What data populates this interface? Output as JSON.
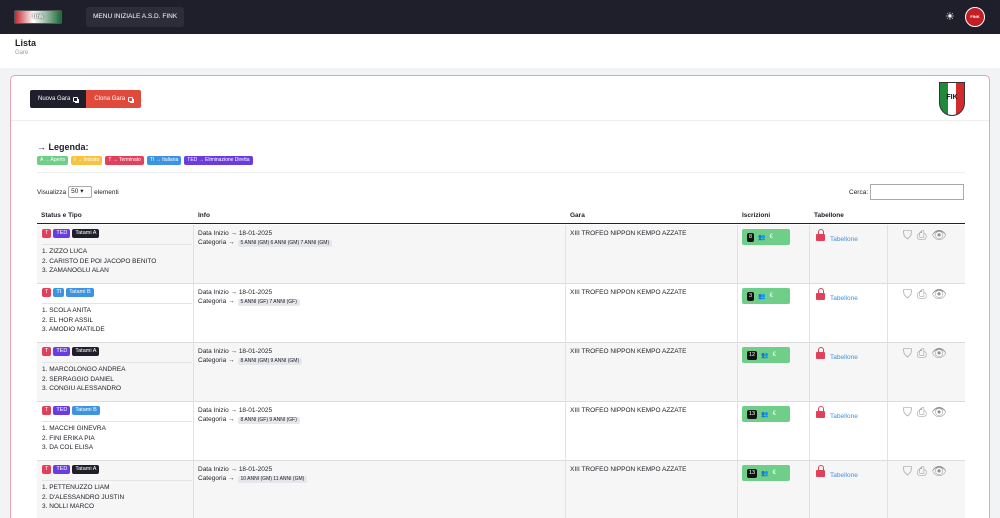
{
  "topbar": {
    "logo_text": "fink",
    "menu_label": "MENU INIZIALE A.S.D. FINK",
    "avatar_text": "FINK"
  },
  "header": {
    "title": "Lista",
    "breadcrumb": "Gare"
  },
  "actions": {
    "new_label": "Nuova Gara",
    "clone_label": "Clona Gara",
    "crest_text": "FIK"
  },
  "legend": {
    "title": "→ Legenda:",
    "items": [
      {
        "label": "A → Aperto",
        "color": "#6fcf88"
      },
      {
        "label": "I → Iniziato",
        "color": "#f5c542"
      },
      {
        "label": "T → Terminato",
        "color": "#e0405a"
      },
      {
        "label": "TI → Italiana",
        "color": "#3d93e0"
      },
      {
        "label": "TED → Eliminazione Diretta",
        "color": "#6a3ce0"
      }
    ]
  },
  "controls": {
    "show_pre": "Visualizza",
    "show_value": "50",
    "show_post": "elementi",
    "search_label": "Cerca:"
  },
  "table": {
    "headers": [
      "Status e Tipo",
      "Info",
      "Gara",
      "Iscrizioni",
      "Tabellone"
    ],
    "rows": [
      {
        "status": "T",
        "tipo": "TED",
        "tatami": "Tatami A",
        "names": [
          "1. ZIZZO LUCA",
          "2. CARISTO DE POI JACOPO BENITO",
          "3. ZAMANOGLU ALAN"
        ],
        "data": "Data Inizio → 18-01-2025",
        "cat_label": "Categoria →",
        "cat": "5 ANNI (GM) 6 ANNI (GM) 7 ANNI (GM)",
        "gara": "XIII TROFEO NIPPON KEMPO AZZATE",
        "iscritti": "8",
        "tab": "Tabellone"
      },
      {
        "status": "T",
        "tipo": "TI",
        "tatami": "Tatami B",
        "names": [
          "1. SCOLA ANITA",
          "2. EL HOR ASSIL",
          "3. AMODIO MATILDE"
        ],
        "data": "Data Inizio → 18-01-2025",
        "cat_label": "Categoria →",
        "cat": "5 ANNI (GF) 7 ANNI (GF)",
        "gara": "XIII TROFEO NIPPON KEMPO AZZATE",
        "iscritti": "3",
        "tab": "Tabellone"
      },
      {
        "status": "T",
        "tipo": "TED",
        "tatami": "Tatami A",
        "names": [
          "1. MARCOLONGO ANDREA",
          "2. SERRAGGIO DANIEL",
          "3. CONGIU ALESSANDRO"
        ],
        "data": "Data Inizio → 18-01-2025",
        "cat_label": "Categoria →",
        "cat": "8 ANNI (GM) 9 ANNI (GM)",
        "gara": "XIII TROFEO NIPPON KEMPO AZZATE",
        "iscritti": "12",
        "tab": "Tabellone"
      },
      {
        "status": "T",
        "tipo": "TED",
        "tatami": "Tatami B",
        "names": [
          "1. MACCHI GINEVRA",
          "2. FINI ERIKA PIA",
          "3. DA COL ELISA"
        ],
        "data": "Data Inizio → 18-01-2025",
        "cat_label": "Categoria →",
        "cat": "8 ANNI (GF) 9 ANNI (GF)",
        "gara": "XIII TROFEO NIPPON KEMPO AZZATE",
        "iscritti": "13",
        "tab": "Tabellone"
      },
      {
        "status": "T",
        "tipo": "TED",
        "tatami": "Tatami A",
        "names": [
          "1. PETTENUZZO LIAM",
          "2. D'ALESSANDRO JUSTIN",
          "3. NOLLI MARCO"
        ],
        "data": "Data Inizio → 18-01-2025",
        "cat_label": "Categoria →",
        "cat": "10 ANNI (GM) 11 ANNI (GM)",
        "gara": "XIII TROFEO NIPPON KEMPO AZZATE",
        "iscritti": "13",
        "tab": "Tabellone"
      }
    ]
  },
  "colors": {
    "status_T": "#e0405a",
    "tipo_TED": "#6a3ce0",
    "tipo_TI": "#3d93e0",
    "tatami_A": "#1f1f2b",
    "tatami_B": "#3d93e0"
  }
}
